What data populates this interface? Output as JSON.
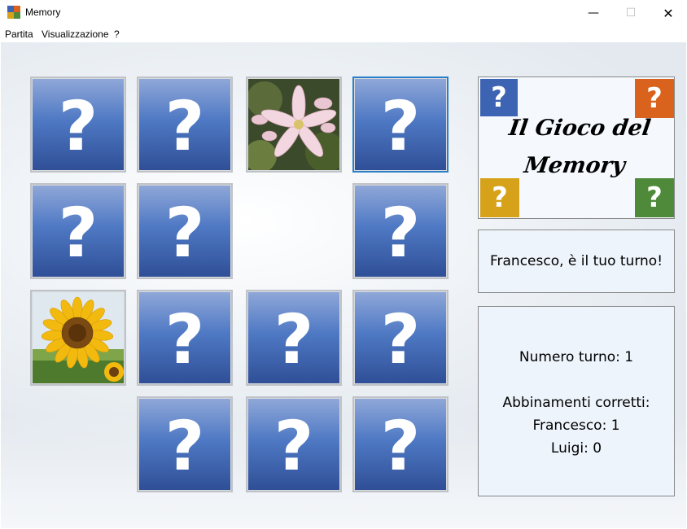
{
  "window": {
    "title": "Memory",
    "icon": "memory-app-icon",
    "controls": {
      "minimize": "—",
      "maximize": "☐",
      "close": "✕"
    }
  },
  "menu": {
    "items": [
      "Partita",
      "Visualizzazione",
      "?"
    ]
  },
  "board": {
    "hidden_symbol": "?",
    "cards": [
      {
        "row": 0,
        "col": 0,
        "state": "hidden"
      },
      {
        "row": 0,
        "col": 1,
        "state": "hidden"
      },
      {
        "row": 0,
        "col": 2,
        "state": "revealed",
        "image": "pink-lily-flower"
      },
      {
        "row": 0,
        "col": 3,
        "state": "hidden",
        "selected": true
      },
      {
        "row": 1,
        "col": 0,
        "state": "hidden"
      },
      {
        "row": 1,
        "col": 1,
        "state": "hidden"
      },
      {
        "row": 1,
        "col": 2,
        "state": "matched-removed"
      },
      {
        "row": 1,
        "col": 3,
        "state": "hidden"
      },
      {
        "row": 2,
        "col": 0,
        "state": "revealed",
        "image": "sunflower"
      },
      {
        "row": 2,
        "col": 1,
        "state": "hidden"
      },
      {
        "row": 2,
        "col": 2,
        "state": "hidden"
      },
      {
        "row": 2,
        "col": 3,
        "state": "hidden"
      },
      {
        "row": 3,
        "col": 0,
        "state": "matched-removed"
      },
      {
        "row": 3,
        "col": 1,
        "state": "hidden"
      },
      {
        "row": 3,
        "col": 2,
        "state": "hidden"
      },
      {
        "row": 3,
        "col": 3,
        "state": "hidden"
      }
    ]
  },
  "logo": {
    "line1": "Il Gioco del",
    "line2": "Memory",
    "corner_symbol": "?",
    "colors": {
      "blue": "#3d63b3",
      "orange": "#d9621c",
      "yellow": "#d6a21a",
      "green": "#4f8a3a"
    }
  },
  "turn_message": "Francesco, è il tuo turno!",
  "score": {
    "turn_line": "Numero turno: 1",
    "matches_heading": "Abbinamenti corretti:",
    "player1_line": "Francesco: 1",
    "player2_line": "Luigi: 0"
  },
  "colors": {
    "card_top": "#8fa7d8",
    "card_bottom": "#2f4f97",
    "selected_border": "#2a7fc9"
  }
}
